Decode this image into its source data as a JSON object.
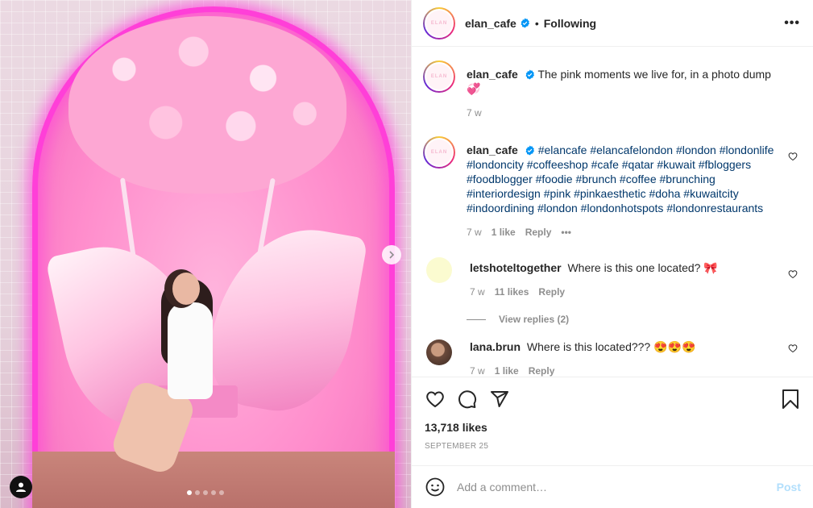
{
  "post": {
    "username": "elan_cafe",
    "header_separator": "•",
    "follow_status": "Following",
    "more_label": "•••",
    "avatar_logo_text": "ELAN",
    "caption": {
      "text": "The pink moments we live for, in a photo dump 💞",
      "age": "7 w"
    }
  },
  "comments": [
    {
      "username": "elan_cafe",
      "hashtags": "#elancafe #elancafelondon #london #londonlife #londoncity #coffeeshop #cafe #qatar #kuwait #fbloggers #foodblogger #foodie #brunch #coffee #brunching #interiordesign #pink #pinkaesthetic #doha #kuwaitcity #indoordining #london #londonhotspots #londonrestaurants",
      "age": "7 w",
      "likes": "1 like",
      "reply": "Reply",
      "more": "•••"
    },
    {
      "username": "letshoteltogether",
      "text": "Where is this one located? 🎀",
      "age": "7 w",
      "likes": "11 likes",
      "reply": "Reply",
      "view_replies": "View replies (2)"
    },
    {
      "username": "lana.brun",
      "text": "Where is this located??? 😍😍😍",
      "age": "7 w",
      "likes": "1 like",
      "reply": "Reply"
    }
  ],
  "actions": {
    "likes": "13,718 likes",
    "date": "SEPTEMBER 25"
  },
  "comment_box": {
    "placeholder": "Add a comment…",
    "post_label": "Post"
  },
  "icons": {
    "verified": "verified-badge-icon",
    "like": "heart-icon",
    "comment": "comment-icon",
    "share": "share-icon",
    "save": "bookmark-icon",
    "emoji": "emoji-icon",
    "next": "chevron-right-icon",
    "tag": "user-tag-icon"
  },
  "colors": {
    "accent": "#0095f6",
    "hashtag": "#00376b",
    "post_disabled": "#b2dffc",
    "muted": "#8e8e8e"
  },
  "media": {
    "carousel_count": 5,
    "carousel_active": 1
  }
}
